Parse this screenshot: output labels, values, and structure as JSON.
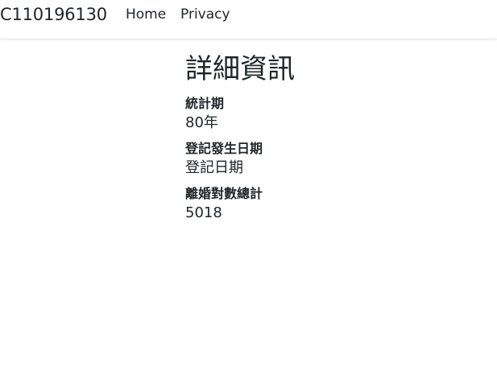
{
  "navbar": {
    "brand": "C110196130",
    "links": [
      {
        "label": "Home"
      },
      {
        "label": "Privacy"
      }
    ]
  },
  "main": {
    "title": "詳細資訊",
    "fields": [
      {
        "label": "統計期",
        "value": "80年"
      },
      {
        "label": "登記發生日期",
        "value": "登記日期"
      },
      {
        "label": "離婚對數總計",
        "value": "5018"
      }
    ]
  }
}
